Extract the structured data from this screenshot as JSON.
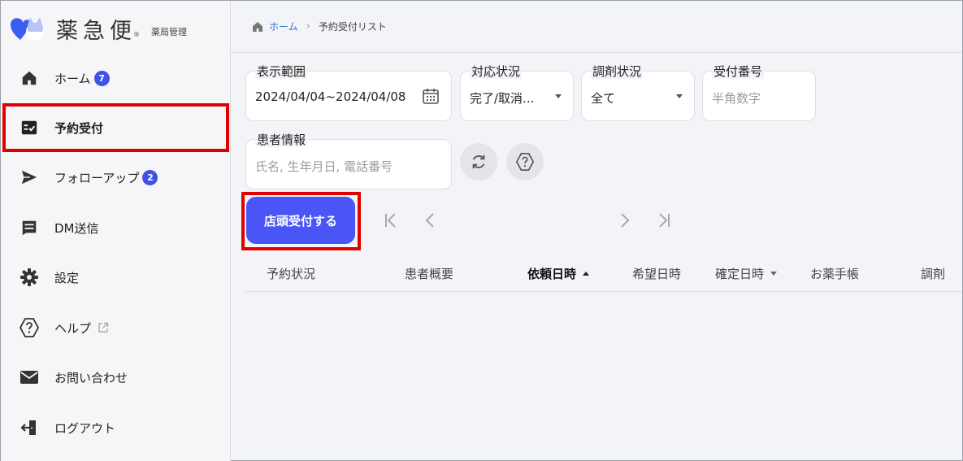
{
  "logo": {
    "text": "薬急便",
    "registered": "®",
    "subtitle": "薬局管理",
    "colors": {
      "blue": "#3d5cf0",
      "lavender": "#b9c3f7"
    }
  },
  "sidebar": {
    "items": [
      {
        "label": "ホーム",
        "icon": "home-icon",
        "badge": "7"
      },
      {
        "label": "予約受付",
        "icon": "reservation-list-icon",
        "active": true
      },
      {
        "label": "フォローアップ",
        "icon": "send-icon",
        "badge": "2"
      },
      {
        "label": "DM送信",
        "icon": "message-icon"
      },
      {
        "label": "設定",
        "icon": "gear-icon"
      },
      {
        "label": "ヘルプ",
        "icon": "help-icon",
        "external": "external-link-icon"
      },
      {
        "label": "お問い合わせ",
        "icon": "mail-icon"
      },
      {
        "label": "ログアウト",
        "icon": "logout-icon"
      }
    ]
  },
  "breadcrumb": {
    "home": "ホーム",
    "current": "予約受付リスト"
  },
  "filters": {
    "range": {
      "label": "表示範囲",
      "value": "2024/04/04~2024/04/08"
    },
    "status": {
      "label": "対応状況",
      "value": "完了/取消..."
    },
    "dispense": {
      "label": "調剤状況",
      "value": "全て"
    },
    "number": {
      "label": "受付番号",
      "placeholder": "半角数字"
    },
    "patient": {
      "label": "患者情報",
      "placeholder": "氏名, 生年月日, 電話番号"
    }
  },
  "actions": {
    "store_reception": "店頭受付する"
  },
  "table": {
    "columns": [
      "予約状況",
      "患者概要",
      "依頼日時",
      "希望日時",
      "確定日時",
      "お薬手帳",
      "調剤"
    ]
  },
  "colors": {
    "accent": "#4a55f5",
    "highlight": "#e00000",
    "badge": "#3f51e6"
  }
}
